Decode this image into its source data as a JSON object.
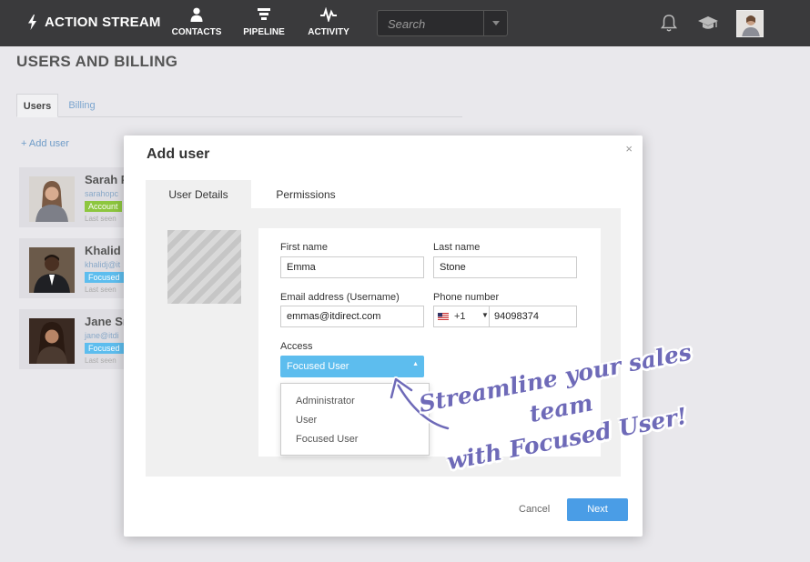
{
  "topbar": {
    "brand": "ACTION STREAM",
    "nav": [
      {
        "label": "CONTACTS",
        "icon": "person-icon"
      },
      {
        "label": "PIPELINE",
        "icon": "funnel-icon"
      },
      {
        "label": "ACTIVITY",
        "icon": "pulse-icon"
      }
    ],
    "search_placeholder": "Search"
  },
  "page": {
    "title": "USERS AND BILLING",
    "tabs": [
      {
        "label": "Users"
      },
      {
        "label": "Billing"
      }
    ],
    "add_user": "+ Add user",
    "users": [
      {
        "name": "Sarah P",
        "email": "sarahopc",
        "badge": "Account",
        "badge_color": "#8dc63f",
        "seen": "Last seen"
      },
      {
        "name": "Khalid",
        "email": "khalidj@it",
        "badge": "Focused",
        "badge_color": "#5dbdee",
        "seen": "Last seen"
      },
      {
        "name": "Jane Sn",
        "email": "jane@itdi",
        "badge": "Focused",
        "badge_color": "#5dbdee",
        "seen": "Last seen"
      }
    ]
  },
  "modal": {
    "title": "Add user",
    "close": "×",
    "tabs": [
      {
        "label": "User Details"
      },
      {
        "label": "Permissions"
      }
    ],
    "form": {
      "first_name_label": "First name",
      "first_name": "Emma",
      "last_name_label": "Last name",
      "last_name": "Stone",
      "email_label": "Email address (Username)",
      "email": "emmas@itdirect.com",
      "phone_label": "Phone number",
      "phone_code": "+1",
      "phone_number": "94098374",
      "access_label": "Access",
      "access_selected": "Focused User",
      "access_options": [
        "Administrator",
        "User",
        "Focused User"
      ]
    },
    "cancel": "Cancel",
    "next": "Next"
  },
  "callout": {
    "line1": "Streamline your sales team",
    "line2": "with Focused User!"
  },
  "colors": {
    "topbar": "#3a3a3c",
    "accent": "#5dbdee",
    "primary_button": "#4a9de6",
    "callout_text": "#6e6ab8"
  }
}
